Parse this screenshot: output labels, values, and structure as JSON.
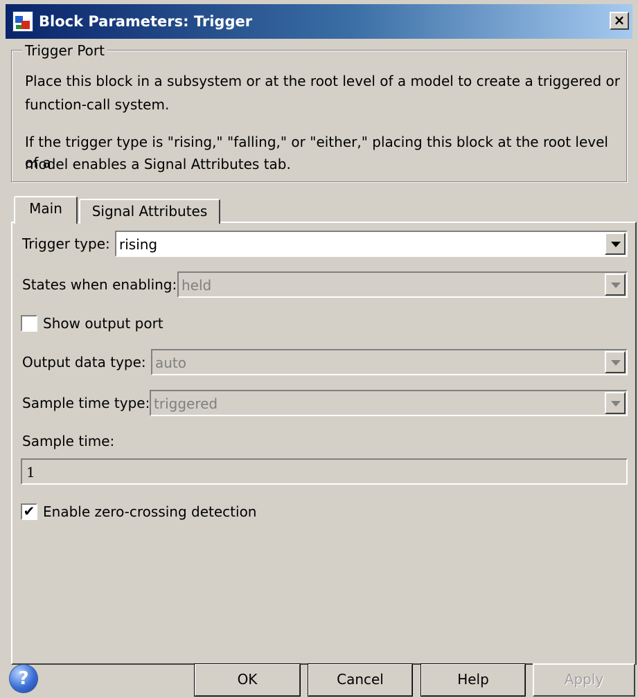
{
  "window": {
    "title": "Block Parameters: Trigger",
    "close_glyph": "×"
  },
  "group": {
    "legend": "Trigger Port",
    "desc1_line1": "Place this block in a subsystem or at the root level of a model to create a triggered or",
    "desc1_line2": "function-call system.",
    "desc2_line1": "If the trigger type is \"rising,\" \"falling,\" or \"either,\" placing this block at the root level of a",
    "desc2_line2": "model enables a Signal Attributes tab."
  },
  "tabs": [
    {
      "label": "Main",
      "active": true
    },
    {
      "label": "Signal Attributes",
      "active": false
    }
  ],
  "main": {
    "trigger_type_label": "Trigger type:",
    "trigger_type_value": "rising",
    "states_label": "States when enabling:",
    "states_value": "held",
    "show_output_label": "Show output port",
    "show_output_checked": false,
    "output_type_label": "Output data type:",
    "output_type_value": "auto",
    "sample_time_type_label": "Sample time type:",
    "sample_time_type_value": "triggered",
    "sample_time_label": "Sample time:",
    "sample_time_value": "1",
    "zero_crossing_label": "Enable zero-crossing detection",
    "zero_crossing_checked": true,
    "check_glyph": "✔"
  },
  "buttons": {
    "ok": "OK",
    "cancel": "Cancel",
    "help": "Help",
    "apply": "Apply",
    "help_icon_glyph": "?"
  },
  "colors": {
    "title_gradient_start": "#0a246a",
    "title_gradient_end": "#a6caf0",
    "face": "#d4d0c8"
  }
}
